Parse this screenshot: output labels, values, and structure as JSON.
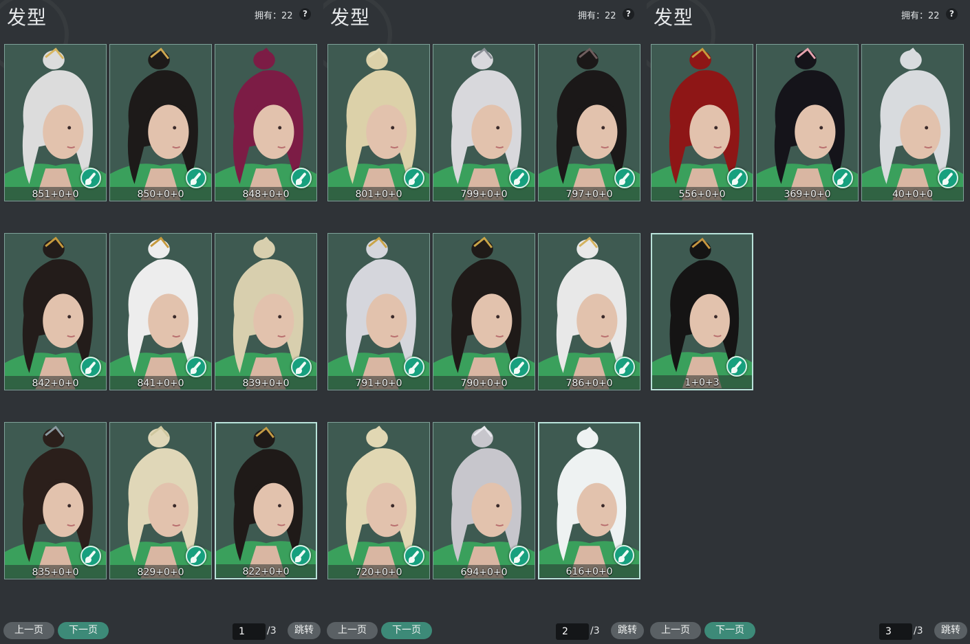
{
  "panels": [
    {
      "title": "发型",
      "owned": "拥有：22",
      "help": "?",
      "prev": "上一页",
      "next": "下一页",
      "page": "1",
      "total": "/3",
      "jump": "跳转",
      "items": [
        {
          "label": "851+0+0",
          "hair": "#dcdcdc",
          "accent": "#d8b660"
        },
        {
          "label": "850+0+0",
          "hair": "#1d1a19",
          "accent": "#cfa850"
        },
        {
          "label": "848+0+0",
          "hair": "#7c1c45",
          "accent": "#7c1c45"
        },
        {
          "label": "842+0+0",
          "hair": "#231c1a",
          "accent": "#c69a3d"
        },
        {
          "label": "841+0+0",
          "hair": "#ededed",
          "accent": "#c69a3d"
        },
        {
          "label": "839+0+0",
          "hair": "#d8cfae",
          "accent": "#d8cfae"
        },
        {
          "label": "835+0+0",
          "hair": "#2b1f1b",
          "accent": "#8b9aa1"
        },
        {
          "label": "829+0+0",
          "hair": "#e0d7b8",
          "accent": "#d0c8a0"
        },
        {
          "label": "822+0+0",
          "hair": "#1f1a18",
          "accent": "#c39b45"
        }
      ]
    },
    {
      "title": "发型",
      "owned": "拥有：22",
      "help": "?",
      "prev": "上一页",
      "next": "下一页",
      "page": "2",
      "total": "/3",
      "jump": "跳转",
      "items": [
        {
          "label": "801+0+0",
          "hair": "#dcd1a9",
          "accent": "#e5dcb8"
        },
        {
          "label": "799+0+0",
          "hair": "#d8d8dc",
          "accent": "#8a8f96"
        },
        {
          "label": "797+0+0",
          "hair": "#1b1818",
          "accent": "#6f5e5e"
        },
        {
          "label": "791+0+0",
          "hair": "#d5d6dc",
          "accent": "#c9a447"
        },
        {
          "label": "790+0+0",
          "hair": "#1f1a18",
          "accent": "#c9a447"
        },
        {
          "label": "786+0+0",
          "hair": "#e8e8e8",
          "accent": "#d3b25e"
        },
        {
          "label": "720+0+0",
          "hair": "#e1d7b3",
          "accent": "#e1d7b3"
        },
        {
          "label": "694+0+0",
          "hair": "#c7c6cc",
          "accent": "#e9e9ee"
        },
        {
          "label": "616+0+0",
          "hair": "#eef2f2",
          "accent": "#eef2f2"
        }
      ]
    },
    {
      "title": "发型",
      "owned": "拥有：22",
      "help": "?",
      "prev": "上一页",
      "next": "下一页",
      "page": "3",
      "total": "/3",
      "jump": "跳转",
      "items": [
        {
          "label": "556+0+0",
          "hair": "#8e1616",
          "accent": "#c89b3d"
        },
        {
          "label": "369+0+0",
          "hair": "#15141a",
          "accent": "#e6a3ae"
        },
        {
          "label": "40+0+0",
          "hair": "#d8dbde",
          "accent": "#d8dbde"
        },
        {
          "label": "1+0+3",
          "hair": "#151414",
          "accent": "#c79640"
        }
      ]
    }
  ]
}
